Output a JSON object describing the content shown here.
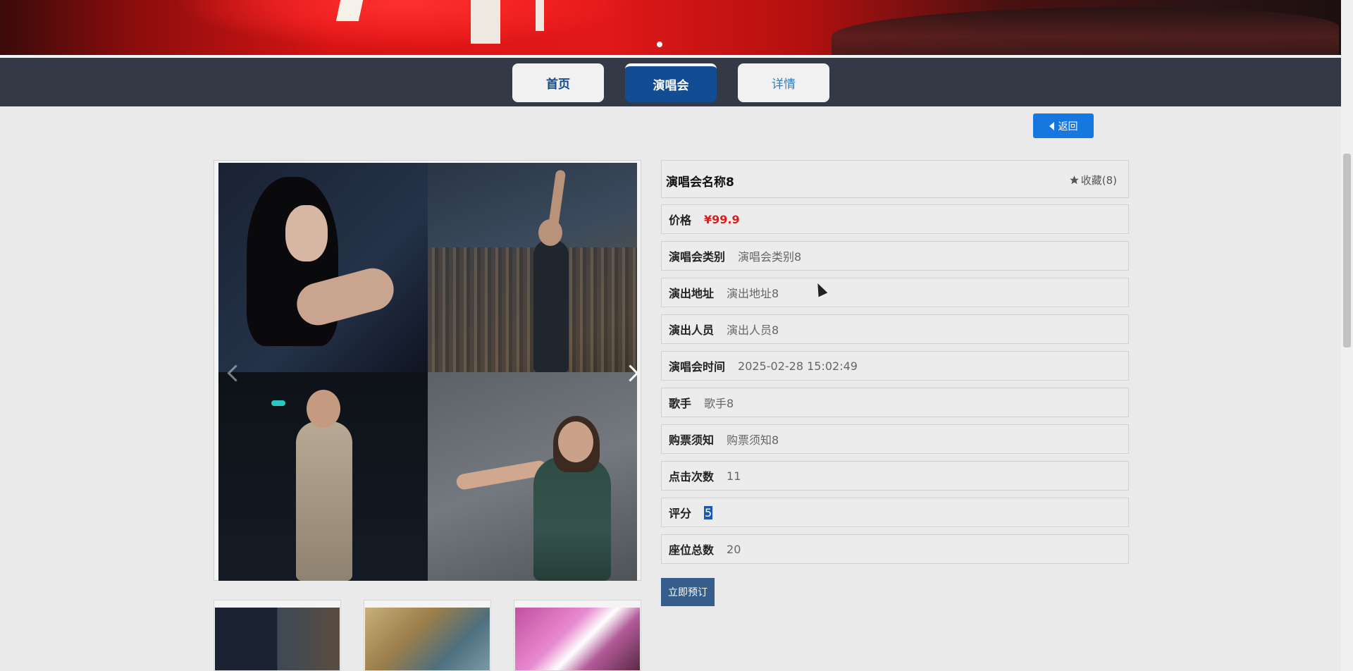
{
  "nav": {
    "tabs": [
      {
        "label": "首页"
      },
      {
        "label": "演唱会"
      },
      {
        "label": "详情"
      }
    ],
    "active_tab": "演唱会"
  },
  "back_button": {
    "label": "返回"
  },
  "detail": {
    "title": "演唱会名称8",
    "favorite_label": "收藏(8)",
    "rows": [
      {
        "label": "价格",
        "value": "¥99.9"
      },
      {
        "label": "演唱会类别",
        "value": "演唱会类别8"
      },
      {
        "label": "演出地址",
        "value": "演出地址8"
      },
      {
        "label": "演出人员",
        "value": "演出人员8"
      },
      {
        "label": "演唱会时间",
        "value": "2025-02-28 15:02:49"
      },
      {
        "label": "歌手",
        "value": "歌手8"
      },
      {
        "label": "购票须知",
        "value": "购票须知8"
      },
      {
        "label": "点击次数",
        "value": "11"
      },
      {
        "label": "评分",
        "value": "5"
      },
      {
        "label": "座位总数",
        "value": "20"
      }
    ],
    "book_button": "立即预订"
  },
  "colors": {
    "nav_bg": "#333a45",
    "active_tab": "#124d93",
    "back_button": "#1677e0",
    "price": "#d81e1e",
    "book_button": "#355e8c"
  },
  "icons": [
    "star-icon",
    "caret-left-icon",
    "chevron-left-icon",
    "chevron-right-icon",
    "carousel-dot-icon"
  ]
}
